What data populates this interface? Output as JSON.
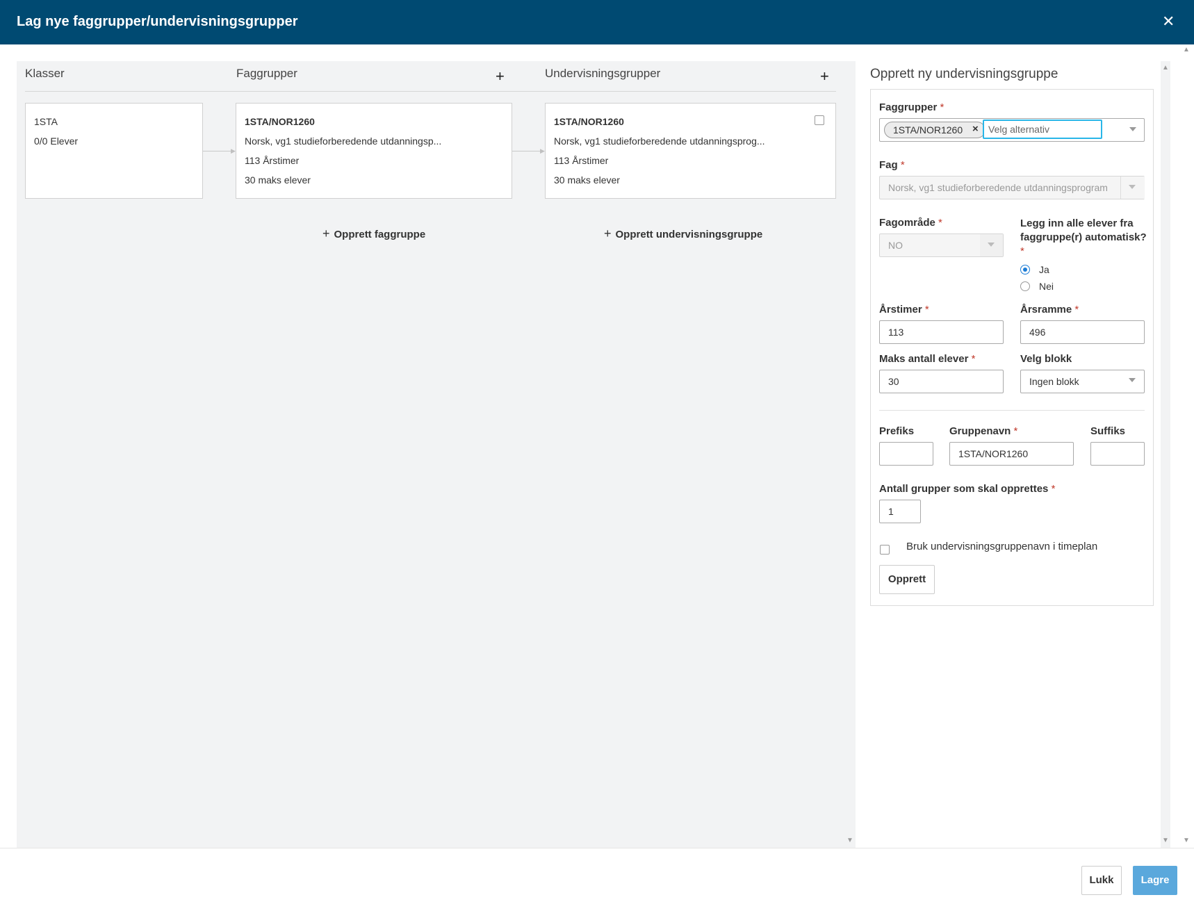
{
  "dialog": {
    "title": "Lag nye faggrupper/undervisningsgrupper",
    "close_icon": "close-icon"
  },
  "columns": {
    "klasser": "Klasser",
    "faggrupper": "Faggrupper",
    "undervisningsgrupper": "Undervisningsgrupper",
    "add_icon": "plus-icon"
  },
  "klasse_card": {
    "name": "1STA",
    "elever": "0/0 Elever"
  },
  "faggruppe_card": {
    "name": "1STA/NOR1260",
    "fag": "Norsk, vg1 studieforberedende utdanningsp...",
    "arstimer": "113 Årstimer",
    "maks": "30 maks elever"
  },
  "undervisningsgruppe_card": {
    "name": "1STA/NOR1260",
    "fag": "Norsk, vg1 studieforberedende utdanningsprog...",
    "arstimer": "113 Årstimer",
    "maks": "30 maks elever"
  },
  "actions": {
    "opprett_faggruppe": "Opprett faggruppe",
    "opprett_undervisningsgruppe": "Opprett undervisningsgruppe"
  },
  "form": {
    "title": "Opprett ny undervisningsgruppe",
    "required_mark": "*",
    "faggrupper": {
      "label": "Faggrupper",
      "tag": "1STA/NOR1260",
      "tag_remove": "×",
      "placeholder": "Velg alternativ"
    },
    "fag": {
      "label": "Fag",
      "value": "Norsk, vg1 studieforberedende utdanningsprogram"
    },
    "fagomrade": {
      "label": "Fagområde",
      "value": "NO"
    },
    "legg_inn": {
      "label": "Legg inn alle elever fra faggruppe(r) automatisk?",
      "options": [
        "Ja",
        "Nei"
      ],
      "selected": "Ja"
    },
    "arstimer": {
      "label": "Årstimer",
      "value": "113"
    },
    "arsramme": {
      "label": "Årsramme",
      "value": "496"
    },
    "maks_elever": {
      "label": "Maks antall elever",
      "value": "30"
    },
    "velg_blokk": {
      "label": "Velg blokk",
      "value": "Ingen blokk"
    },
    "prefiks": {
      "label": "Prefiks",
      "value": ""
    },
    "gruppenavn": {
      "label": "Gruppenavn",
      "value": "1STA/NOR1260"
    },
    "suffiks": {
      "label": "Suffiks",
      "value": ""
    },
    "antall_grupper": {
      "label": "Antall grupper som skal opprettes",
      "value": "1"
    },
    "bruk_navn": {
      "label": "Bruk undervisningsgruppenavn i timeplan",
      "checked": false
    },
    "opprett_button": "Opprett"
  },
  "footer": {
    "lukk": "Lukk",
    "lagre": "Lagre"
  },
  "colors": {
    "header": "#004a72",
    "primary_button": "#5aa8dc",
    "radio_selected": "#1c7cd6",
    "required": "#c0392b"
  }
}
